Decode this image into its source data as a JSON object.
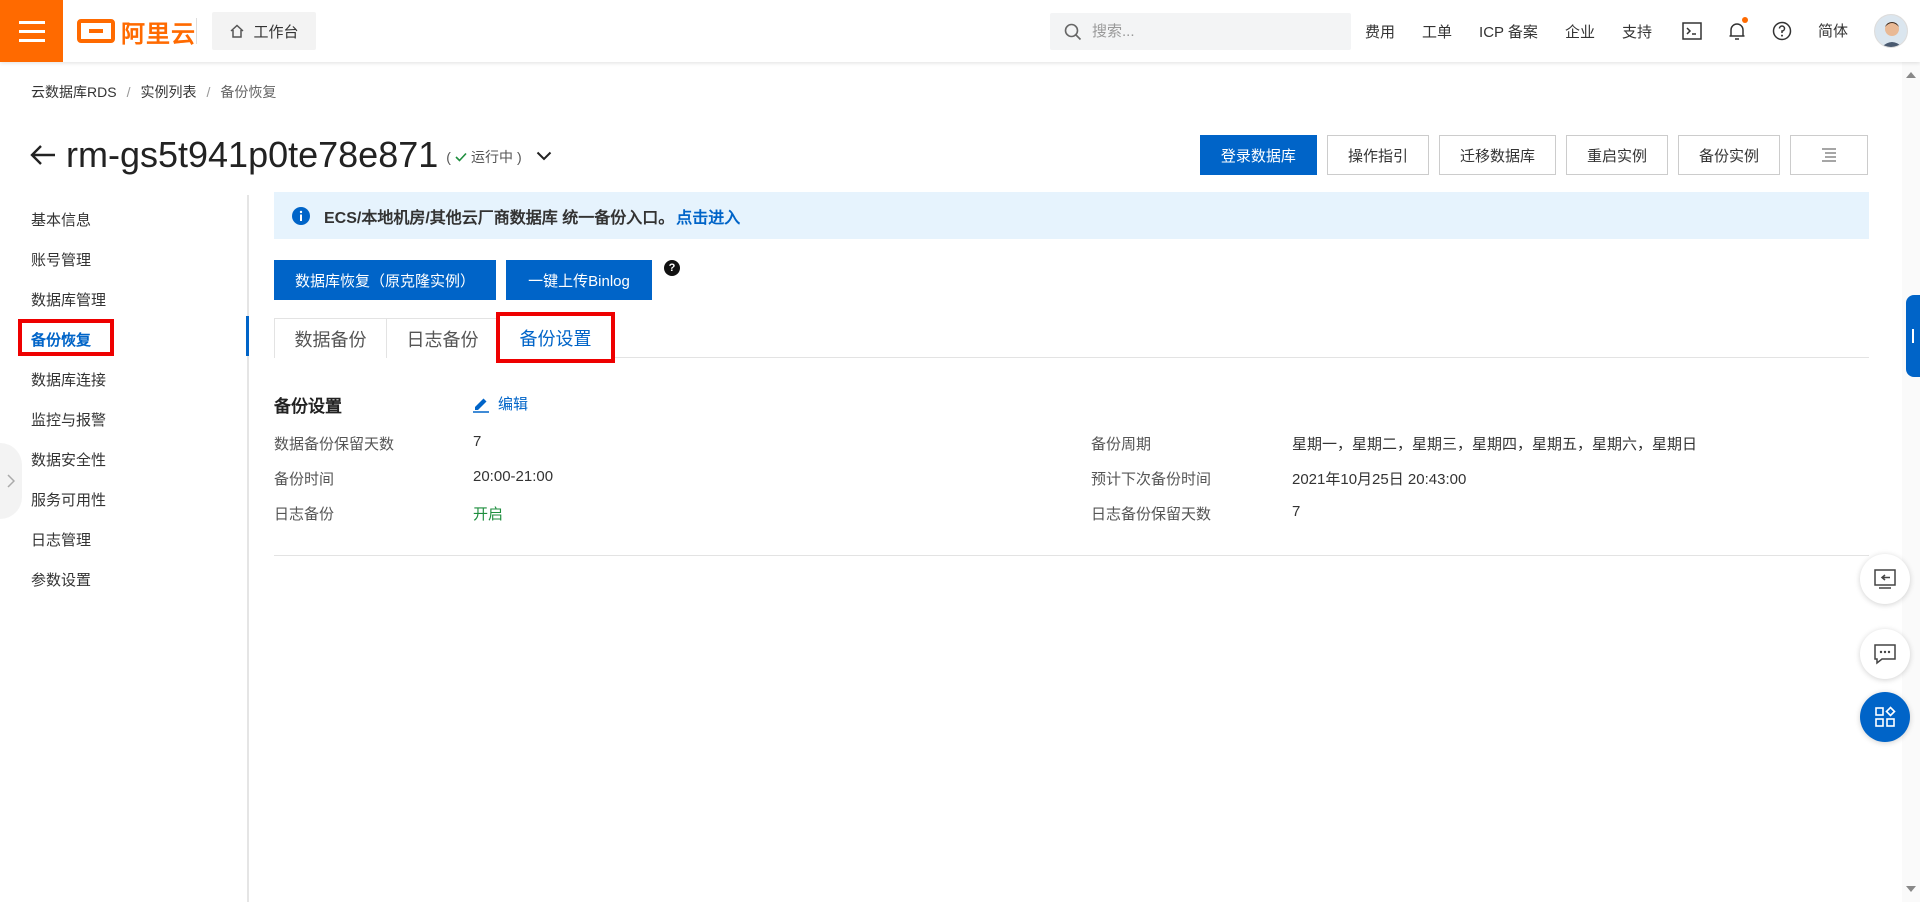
{
  "header": {
    "logo_text": "阿里云",
    "workbench_label": "工作台",
    "search_placeholder": "搜索...",
    "nav_links": [
      "费用",
      "工单",
      "ICP 备案",
      "企业",
      "支持"
    ],
    "language": "简体",
    "accent_color": "#ff6a00"
  },
  "breadcrumb": [
    "云数据库RDS",
    "实例列表",
    "备份恢复"
  ],
  "instance": {
    "name": "rm-gs5t941p0te78e871",
    "status": "运行中"
  },
  "actions": [
    "登录数据库",
    "操作指引",
    "迁移数据库",
    "重启实例",
    "备份实例"
  ],
  "sidebar": {
    "items": [
      "基本信息",
      "账号管理",
      "数据库管理",
      "备份恢复",
      "数据库连接",
      "监控与报警",
      "数据安全性",
      "服务可用性",
      "日志管理",
      "参数设置"
    ],
    "active": "备份恢复"
  },
  "notice": {
    "text": "ECS/本地机房/其他云厂商数据库 统一备份入口。",
    "link": "点击进入"
  },
  "op_buttons": {
    "restore": "数据库恢复（原克隆实例）",
    "upload": "一键上传Binlog"
  },
  "tabs": [
    "数据备份",
    "日志备份",
    "备份设置"
  ],
  "active_tab": "备份设置",
  "settings": {
    "title": "备份设置",
    "edit": "编辑",
    "left": [
      {
        "label": "数据备份保留天数",
        "value": "7"
      },
      {
        "label": "备份时间",
        "value": "20:00-21:00"
      },
      {
        "label": "日志备份",
        "value": "开启"
      }
    ],
    "right": [
      {
        "label": "备份周期",
        "value": "星期一，星期二，星期三，星期四，星期五，星期六，星期日"
      },
      {
        "label": "预计下次备份时间",
        "value": "2021年10月25日 20:43:00"
      },
      {
        "label": "日志备份保留天数",
        "value": "7"
      }
    ]
  },
  "colors": {
    "primary": "#0064c8",
    "highlight": "#e00000",
    "success": "#1e8e3e"
  }
}
